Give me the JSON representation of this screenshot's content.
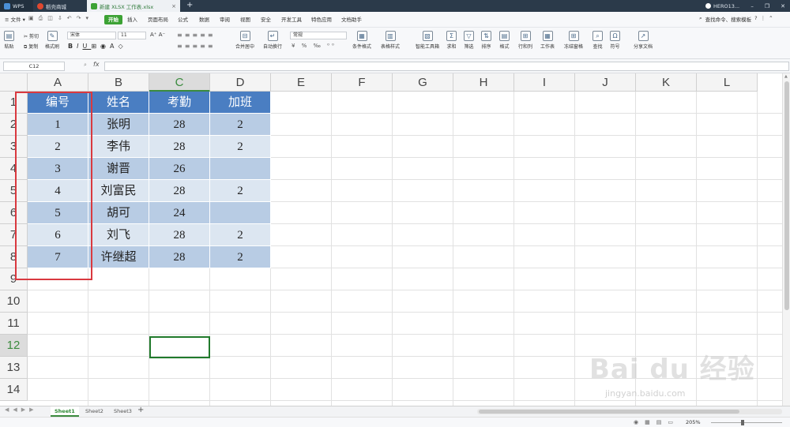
{
  "titlebar": {
    "tabs": [
      {
        "label": "WPS",
        "icon": "wps-logo-icon"
      },
      {
        "label": "稻壳商城",
        "icon": "daoke-logo-icon"
      },
      {
        "label": "新建 XLSX 工作表.xlsx",
        "icon": "xlsx-file-icon"
      }
    ],
    "user_name": "HERO13...",
    "colors": {
      "titlebar_bg": "#2b3a4a",
      "active_tab_text": "#2f7a3a"
    }
  },
  "menu": {
    "file_label": "文件",
    "items": [
      "开始",
      "插入",
      "页面布局",
      "公式",
      "数据",
      "审阅",
      "视图",
      "安全",
      "开发工具",
      "特色应用",
      "文档助手"
    ],
    "active_item": "开始",
    "search_label": "查找命令、搜索模板",
    "accent": "#3ca234"
  },
  "ribbon": {
    "paste": "粘贴",
    "cut": "剪切",
    "copy": "复制",
    "format_painter": "格式刷",
    "font_name": "宋体",
    "font_size": "11",
    "merge_center": "合并居中",
    "wrap_text": "自动换行",
    "number_format": "常规",
    "cond_format": "条件格式",
    "table_style": "表格样式",
    "smart_toolbox": "智能工具箱",
    "sum": "求和",
    "filter": "筛选",
    "sort": "排序",
    "format": "格式",
    "rows_cols": "行和列",
    "worksheet": "工作表",
    "freeze_panes": "冻结窗格",
    "find": "查找",
    "symbol": "符号",
    "share_doc": "分享文档"
  },
  "formula_bar": {
    "name_box": "C12",
    "fx_label": "fx",
    "value": ""
  },
  "sheet": {
    "columns": [
      "A",
      "B",
      "C",
      "D",
      "E",
      "F",
      "G",
      "H",
      "I",
      "J",
      "K",
      "L"
    ],
    "selected_column": "C",
    "rows": [
      "1",
      "2",
      "3",
      "4",
      "5",
      "6",
      "7",
      "8",
      "9",
      "10",
      "11",
      "12",
      "13",
      "14"
    ],
    "selected_row": "12",
    "header": [
      "编号",
      "姓名",
      "考勤",
      "加班"
    ],
    "data": [
      [
        "1",
        "张明",
        "28",
        "2"
      ],
      [
        "2",
        "李伟",
        "28",
        "2"
      ],
      [
        "3",
        "谢晋",
        "26",
        ""
      ],
      [
        "4",
        "刘富民",
        "28",
        "2"
      ],
      [
        "5",
        "胡可",
        "24",
        ""
      ],
      [
        "6",
        "刘飞",
        "28",
        "2"
      ],
      [
        "7",
        "许继超",
        "28",
        "2"
      ]
    ],
    "colors": {
      "header_fill": "#4a7ec2",
      "band_dark": "#b8cce4",
      "band_light": "#dce6f1",
      "highlight_box": "#d9393f",
      "active_cell": "#217a2c"
    }
  },
  "sheet_tabs": [
    "Sheet1",
    "Sheet2",
    "Sheet3"
  ],
  "active_sheet": "Sheet1",
  "status": {
    "zoom": "205%"
  },
  "watermark": {
    "text": "Bai du 经验",
    "url": "jingyan.baidu.com"
  }
}
